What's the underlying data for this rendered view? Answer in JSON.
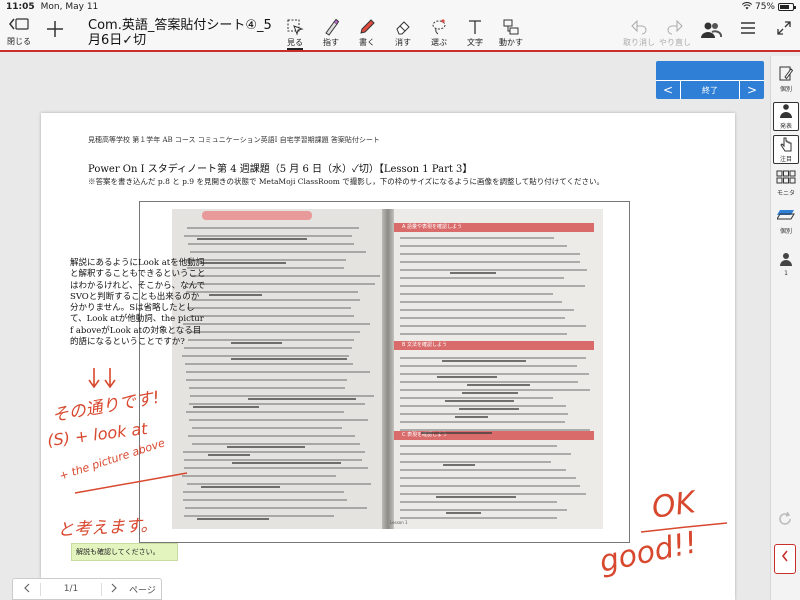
{
  "status_bar": {
    "time": "11:05",
    "date": "Mon, May 11",
    "wifi": "wifi-icon",
    "battery_percent": "75%",
    "battery_level": 0.75
  },
  "toolbar": {
    "close_label": "閉じる",
    "add_icon": "plus-icon",
    "doc_title": "Com.英語_答案貼付シート④_5月6日✓切",
    "tools": [
      {
        "id": "view",
        "label": "見る",
        "icon": "cursor-icon",
        "active": true
      },
      {
        "id": "point",
        "label": "指す",
        "icon": "pointer-pen-icon",
        "active": false
      },
      {
        "id": "write",
        "label": "書く",
        "icon": "pen-icon",
        "active": false
      },
      {
        "id": "erase",
        "label": "消す",
        "icon": "eraser-icon",
        "active": false
      },
      {
        "id": "select",
        "label": "選ぶ",
        "icon": "lasso-icon",
        "active": false
      },
      {
        "id": "text",
        "label": "文字",
        "icon": "text-icon",
        "active": false
      },
      {
        "id": "move",
        "label": "動かす",
        "icon": "move-icon",
        "active": false
      }
    ],
    "undo_label": "取り消し",
    "redo_label": "やり直し",
    "accent_color": "#c9302c"
  },
  "presentation_nav": {
    "prev": "<",
    "end_label": "終了",
    "next": ">",
    "color": "#2f7fd6"
  },
  "document": {
    "header": "見穂高等学校 第１学年 AB コース コミュニケーション英語Ⅰ 自宅学習期課題 答案貼付シート",
    "title": "Power On I スタディノート第 4 週課題（5 月 6 日（水）✓切）【Lesson 1 Part 3】",
    "instruction": "※答案を書き込んだ p.8 と p.9 を見開きの状態で MetaMoji ClassRoom で撮影し，下の枠のサイズになるように画像を調整して貼り付けてください。",
    "question_text": "解説にあるようにLook atを他動詞と解釈することもできるということはわかるけれど、そこから、なんでSVOと判断することも出来るのか分かりません。Sは省略したとして、Look atが他動詞、the picturf aboveがLook atの対象となる目的語になるということですか?",
    "confirm_note": "解説も確認してください。",
    "photo_sections": [
      "A 語彙や表現を確認しよう",
      "B 文法を確認しよう",
      "C 表現を確認しよう"
    ],
    "photo_footer": "Lesson 1"
  },
  "handwriting": {
    "teacher_reply_1": "その通りです!",
    "formula": "(S) + look at",
    "formula_2": "+ the picture above",
    "teacher_reply_2": "と考えます。",
    "ok": "OK",
    "good": "good!!",
    "ink_color": "#d8482e"
  },
  "page_nav": {
    "current": "1/1",
    "label": "ページ"
  },
  "sidebar": [
    {
      "id": "individual",
      "label": "個別",
      "icon": "edit-doc-icon",
      "boxed": false
    },
    {
      "id": "presentation",
      "label": "発表",
      "icon": "presenter-icon",
      "boxed": true
    },
    {
      "id": "attention",
      "label": "注目",
      "icon": "hand-pointer-icon",
      "boxed": true
    },
    {
      "id": "monitor",
      "label": "モニタ",
      "icon": "grid-icon",
      "boxed": false
    },
    {
      "id": "individual2",
      "label": "個別",
      "icon": "stack-icon",
      "boxed": false
    },
    {
      "id": "participants",
      "label": "1",
      "icon": "person-icon",
      "boxed": false
    }
  ]
}
